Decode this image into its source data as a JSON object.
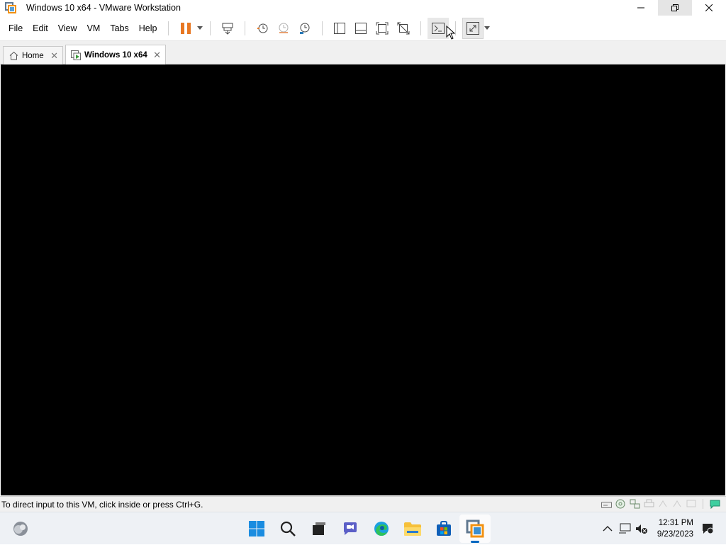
{
  "window": {
    "title": "Windows 10 x64 - VMware Workstation",
    "icon": "vmware-logo-icon"
  },
  "menu": {
    "items": [
      "File",
      "Edit",
      "View",
      "VM",
      "Tabs",
      "Help"
    ]
  },
  "toolbar": {
    "buttons": [
      "pause-icon",
      "send-ctrl-alt-del-icon",
      "snapshot-icon",
      "revert-snapshot-icon",
      "snapshot-manager-icon",
      "library-icon",
      "thumbnail-icon",
      "full-screen-icon",
      "unity-icon",
      "console-view-icon",
      "stretch-guest-icon"
    ],
    "accent_color": "#e87722"
  },
  "tabs": [
    {
      "label": "Home",
      "icon": "home-icon",
      "active": false
    },
    {
      "label": "Windows 10 x64",
      "icon": "vm-icon",
      "active": true
    }
  ],
  "status": {
    "message": "To direct input to this VM, click inside or press Ctrl+G."
  },
  "taskbar": {
    "apps": [
      "start-icon",
      "search-icon",
      "task-view-icon",
      "chat-icon",
      "edge-icon",
      "file-explorer-icon",
      "store-icon",
      "vmware-icon"
    ],
    "time": "12:31 PM",
    "date": "9/23/2023"
  }
}
